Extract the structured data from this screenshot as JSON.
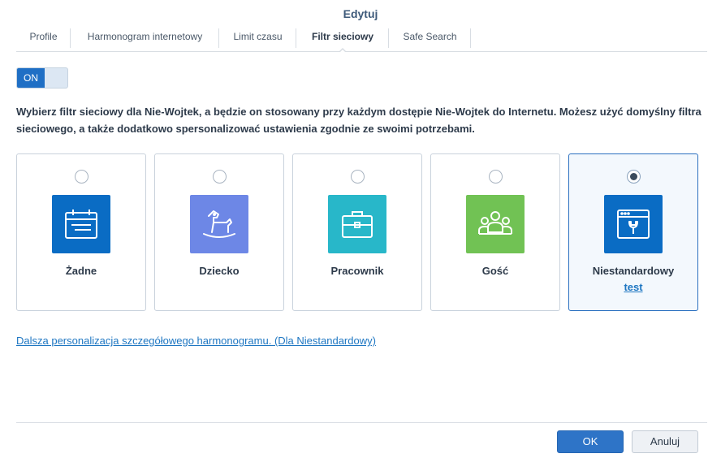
{
  "window": {
    "title": "Edytuj"
  },
  "tabs": [
    {
      "label": "Profile"
    },
    {
      "label": "Harmonogram internetowy"
    },
    {
      "label": "Limit czasu"
    },
    {
      "label": "Filtr sieciowy",
      "active": true
    },
    {
      "label": "Safe Search"
    }
  ],
  "toggle": {
    "label": "ON",
    "state": true
  },
  "description": "Wybierz filtr sieciowy dla Nie-Wojtek, a będzie on stosowany przy każdym dostępie Nie-Wojtek do Internetu. Możesz użyć domyślny filtra sieciowego, a także dodatkowo spersonalizować ustawienia zgodnie ze swoimi potrzebami.",
  "filters": [
    {
      "label": "Żadne",
      "icon": "calendar-icon",
      "color": "#0a6cc4",
      "selected": false
    },
    {
      "label": "Dziecko",
      "icon": "rocking-horse-icon",
      "color": "#6d87e6",
      "selected": false
    },
    {
      "label": "Pracownik",
      "icon": "briefcase-icon",
      "color": "#28b7c9",
      "selected": false
    },
    {
      "label": "Gość",
      "icon": "people-icon",
      "color": "#71c254",
      "selected": false
    },
    {
      "label": "Niestandardowy",
      "icon": "custom-settings-icon",
      "color": "#0a6cc4",
      "selected": true,
      "sublabel": "test"
    }
  ],
  "link": {
    "label": "Dalsza personalizacja szczegółowego harmonogramu. (Dla Niestandardowy)"
  },
  "buttons": {
    "ok": "OK",
    "cancel": "Anuluj"
  },
  "colors": {
    "accent": "#2e74c7",
    "link": "#1d76c2",
    "selected_border": "#2a6fbf"
  }
}
